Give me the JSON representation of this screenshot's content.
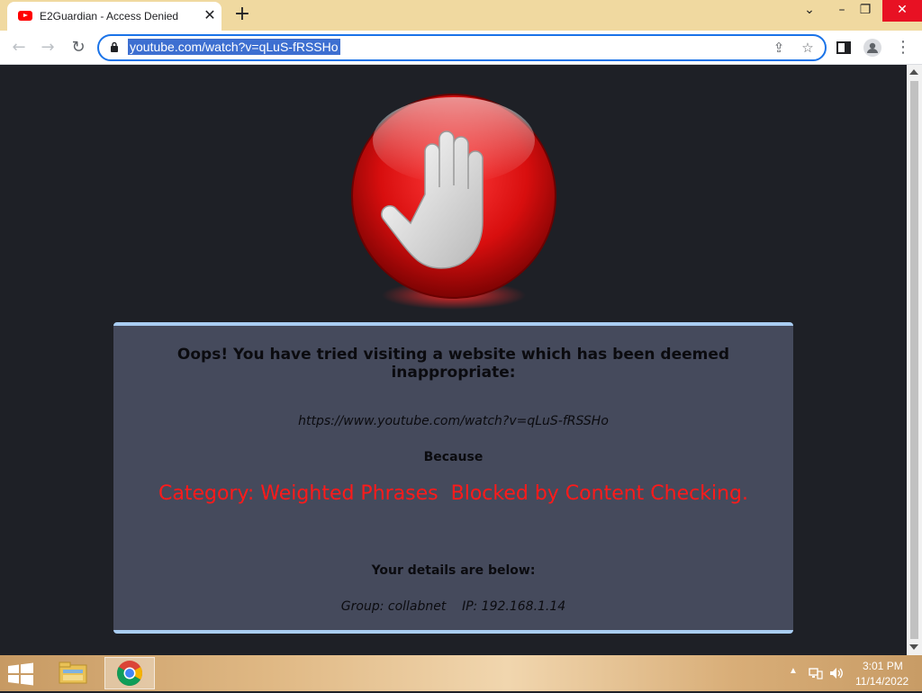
{
  "browser": {
    "tab": {
      "title": "E2Guardian - Access Denied",
      "favicon": "youtube-icon"
    },
    "address_bar": {
      "url": "youtube.com/watch?v=qLuS-fRSSHo"
    }
  },
  "page": {
    "headline": "Oops! You have tried visiting a website which has been deemed inappropriate:",
    "blocked_url": "https://www.youtube.com/watch?v=qLuS-fRSSHo",
    "because_label": "Because",
    "reason": "Category: Weighted Phrases  Blocked by Content Checking.",
    "details_label": "Your details are below:",
    "details_line": "Group: collabnet    IP: 192.168.1.14",
    "colors": {
      "panel": "#454a5c",
      "reason": "#ff1a1a",
      "panel_border": "#a9cdf2",
      "background": "#1e2026"
    }
  },
  "taskbar": {
    "time": "3:01 PM",
    "date": "11/14/2022"
  }
}
